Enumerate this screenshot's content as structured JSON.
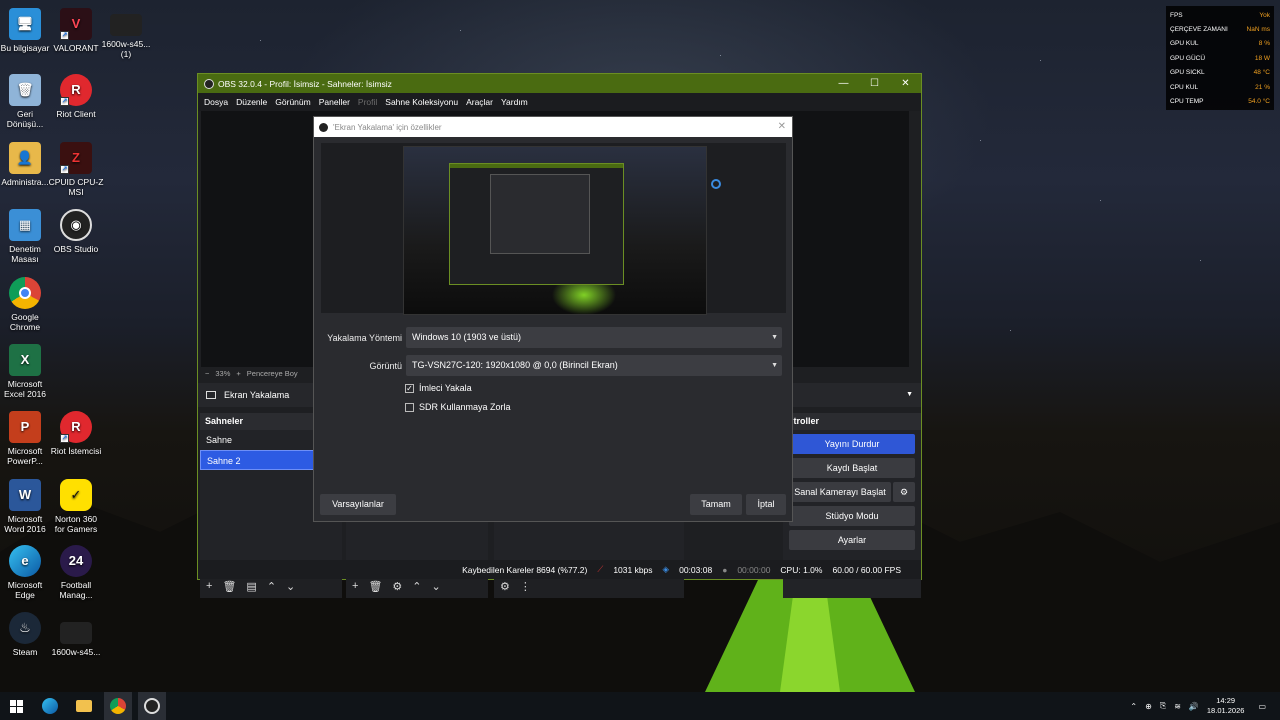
{
  "desktop_icons": [
    {
      "label": "Bu bilgisayar",
      "icon": "computer-icon"
    },
    {
      "label": "VALORANT",
      "icon": "valorant-icon"
    },
    {
      "label": "1600w-s45...\n(1)",
      "icon": "image-file-icon"
    },
    {
      "label": "Geri\nDönüşü...",
      "icon": "recycle-bin-icon"
    },
    {
      "label": "Riot Client",
      "icon": "riot-client-icon"
    },
    {
      "label": "Administra...",
      "icon": "user-folder-icon"
    },
    {
      "label": "CPUID CPU-Z\nMSI",
      "icon": "cpuz-icon"
    },
    {
      "label": "Denetim\nMasası",
      "icon": "control-panel-icon"
    },
    {
      "label": "OBS Studio",
      "icon": "obs-icon"
    },
    {
      "label": "Google\nChrome",
      "icon": "chrome-icon"
    },
    {
      "label": "Microsoft\nExcel 2016",
      "icon": "excel-icon"
    },
    {
      "label": "Microsoft\nPowerP...",
      "icon": "powerpoint-icon"
    },
    {
      "label": "Riot İstemcisi",
      "icon": "riot-client-icon"
    },
    {
      "label": "Microsoft\nWord 2016",
      "icon": "word-icon"
    },
    {
      "label": "Norton 360\nfor Gamers",
      "icon": "norton-icon"
    },
    {
      "label": "Microsoft\nEdge",
      "icon": "edge-icon"
    },
    {
      "label": "Football\nManag...",
      "icon": "football-manager-icon"
    },
    {
      "label": "Steam",
      "icon": "steam-icon"
    },
    {
      "label": "1600w-s45...",
      "icon": "image-file-icon"
    }
  ],
  "hw_monitor": [
    {
      "label": "FPS",
      "value": "Yok"
    },
    {
      "label": "ÇERÇEVE ZAMANI",
      "value": "NaN ms"
    },
    {
      "label": "GPU KUL",
      "value": "8 %"
    },
    {
      "label": "GPU GÜCÜ",
      "value": "18 W"
    },
    {
      "label": "GPU SICKL",
      "value": "48 °C"
    },
    {
      "label": "CPU KUL",
      "value": "21 %"
    },
    {
      "label": "CPU TEMP",
      "value": "54.0 °C"
    }
  ],
  "obs": {
    "title": "OBS 32.0.4 - Profil: İsimsiz - Sahneler: İsimsiz",
    "menu": [
      "Dosya",
      "Düzenle",
      "Görünüm",
      "Paneller",
      "Profil",
      "Sahne Koleksiyonu",
      "Araçlar",
      "Yardım"
    ],
    "zoom": "33%",
    "fit_label": "Pencereye Boy",
    "source_name": "Ekran Yakalama",
    "scenes_title": "Sahneler",
    "scenes": [
      "Sahne",
      "Sahne 2"
    ],
    "controls_title": "ntroller",
    "controls": {
      "stop_stream": "Yayını Durdur",
      "start_record": "Kaydı Başlat",
      "virtual_cam": "Sanal Kamerayı Başlat",
      "studio_mode": "Stüdyo Modu",
      "settings": "Ayarlar"
    },
    "status": {
      "dropped": "Kaybedilen Kareler 8694 (%77.2)",
      "bitrate": "1031 kbps",
      "stream_time": "00:03:08",
      "record_time": "00:00:00",
      "cpu": "CPU: 1.0%",
      "fps": "60.00 / 60.00 FPS"
    }
  },
  "dialog": {
    "title": "'Ekran Yakalama' için özellikler",
    "method_label": "Yakalama Yöntemi",
    "method_value": "Windows 10 (1903 ve üstü)",
    "display_label": "Görüntü",
    "display_value": "TG-VSN27C-120: 1920x1080 @ 0,0 (Birincil Ekran)",
    "capture_cursor": "İmleci Yakala",
    "capture_cursor_checked": true,
    "force_sdr": "SDR Kullanmaya Zorla",
    "force_sdr_checked": false,
    "defaults_button": "Varsayılanlar",
    "ok_button": "Tamam",
    "cancel_button": "İptal"
  },
  "taskbar": {
    "time": "14:29",
    "date": "18.01.2026"
  }
}
